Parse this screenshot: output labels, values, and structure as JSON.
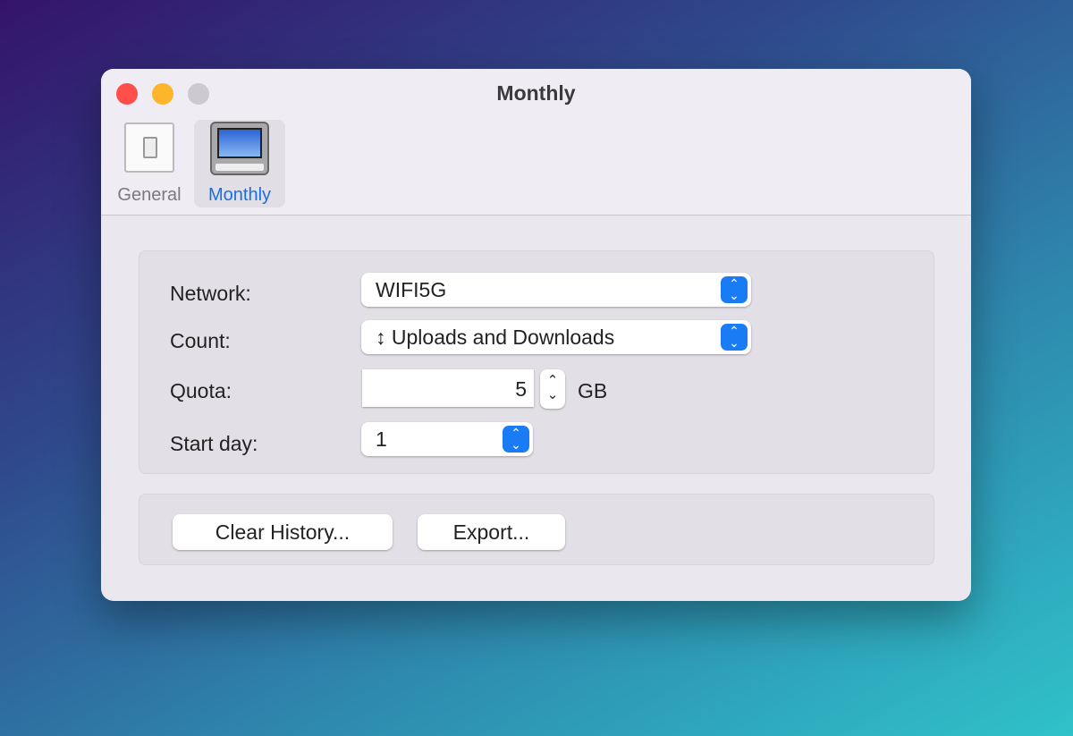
{
  "window": {
    "title": "Monthly"
  },
  "toolbar": {
    "tabs": [
      {
        "label": "General",
        "icon": "switch-icon"
      },
      {
        "label": "Monthly",
        "icon": "monitor-icon",
        "selected": true
      }
    ]
  },
  "form": {
    "network": {
      "label": "Network:",
      "value": "WIFI5G"
    },
    "count": {
      "label": "Count:",
      "value": "↕ Uploads and Downloads"
    },
    "quota": {
      "label": "Quota:",
      "value": "5",
      "unit": "GB"
    },
    "start_day": {
      "label": "Start day:",
      "value": "1"
    }
  },
  "actions": {
    "clear": "Clear History...",
    "export": "Export..."
  },
  "colors": {
    "accent": "#1a7cf5",
    "close": "#fe4f4a",
    "minimize": "#fdb52c",
    "zoom": "#cdc9d0"
  }
}
